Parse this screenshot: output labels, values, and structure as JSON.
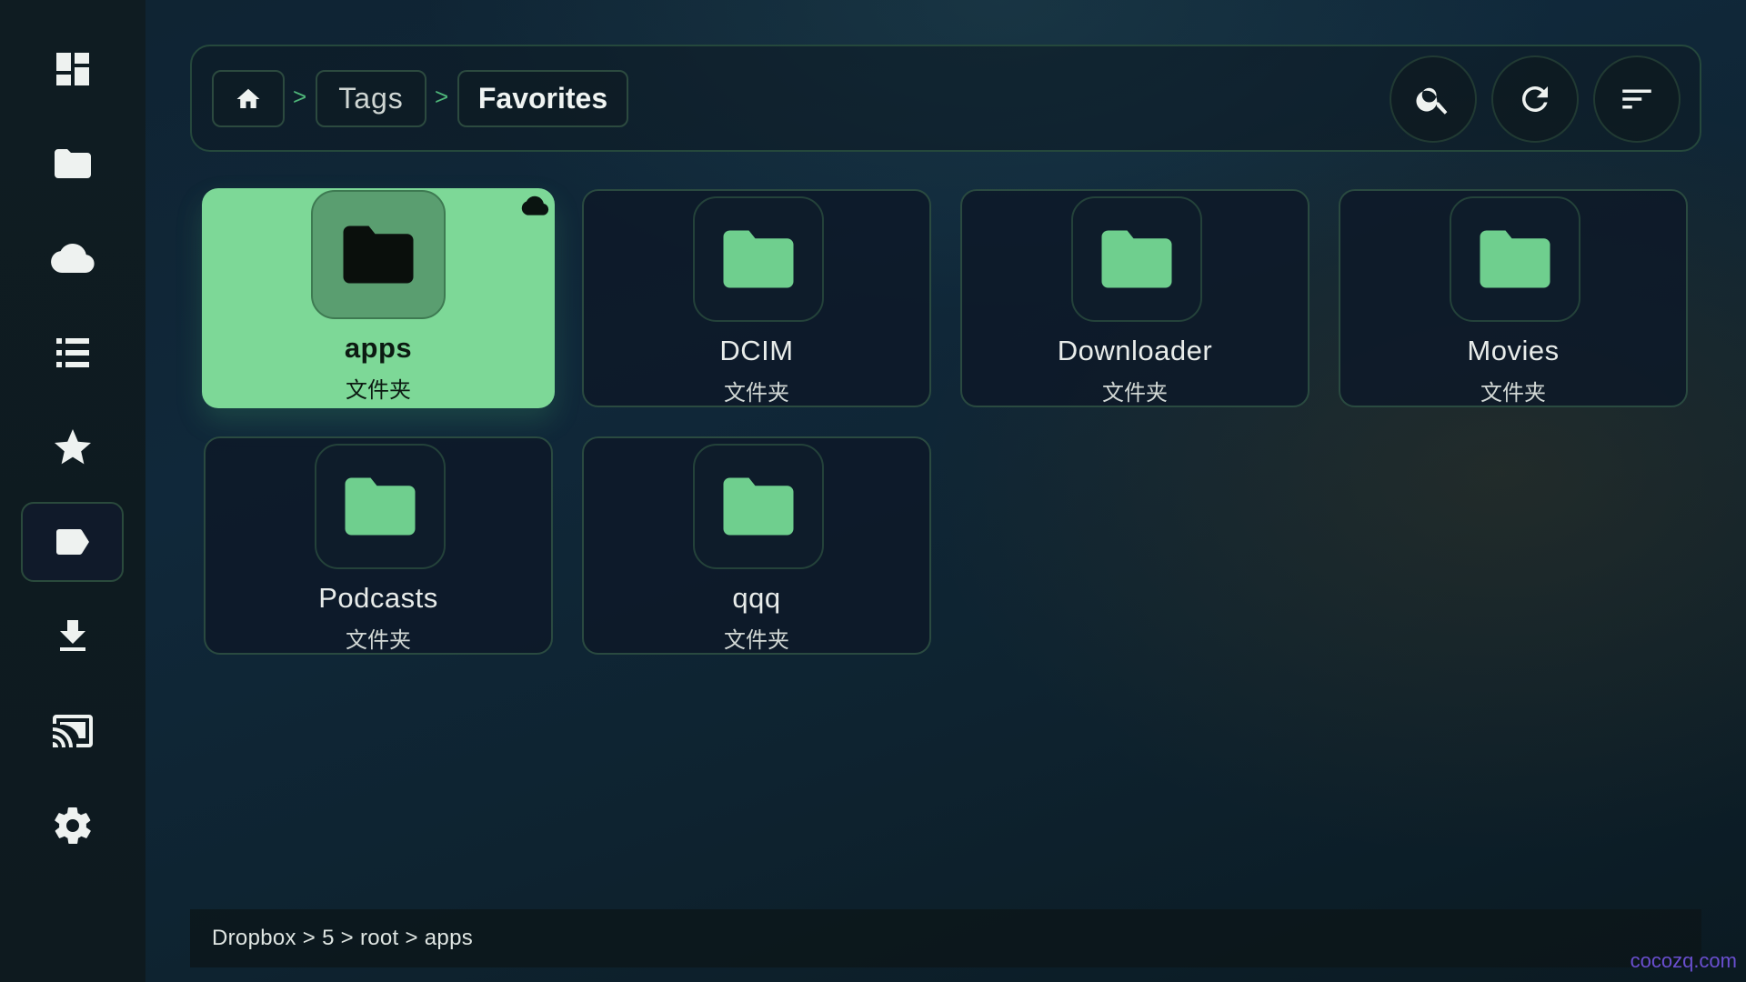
{
  "sidebar": {
    "items": [
      {
        "icon": "dashboard-icon"
      },
      {
        "icon": "folder-icon"
      },
      {
        "icon": "cloud-icon"
      },
      {
        "icon": "list-icon"
      },
      {
        "icon": "star-icon"
      },
      {
        "icon": "tag-icon",
        "active": true
      },
      {
        "icon": "download-icon"
      },
      {
        "icon": "cast-icon"
      },
      {
        "icon": "settings-icon"
      }
    ]
  },
  "breadcrumb": {
    "home_icon": "home-icon",
    "separator": ">",
    "items": [
      "Tags",
      "Favorites"
    ]
  },
  "toolbar": {
    "search_icon": "search-icon",
    "refresh_icon": "refresh-icon",
    "sort_icon": "sort-icon"
  },
  "files": [
    {
      "name": "apps",
      "type": "文件夹",
      "selected": true,
      "cloud": true
    },
    {
      "name": "DCIM",
      "type": "文件夹"
    },
    {
      "name": "Downloader",
      "type": "文件夹"
    },
    {
      "name": "Movies",
      "type": "文件夹"
    },
    {
      "name": "Podcasts",
      "type": "文件夹"
    },
    {
      "name": "qqq",
      "type": "文件夹"
    }
  ],
  "footer": {
    "path": "Dropbox > 5 > root > apps"
  },
  "watermark": "cocozq.com",
  "colors": {
    "accent": "#7dd897",
    "folder": "#6fcf8e",
    "sidebar_bg": "#0f1c22"
  }
}
